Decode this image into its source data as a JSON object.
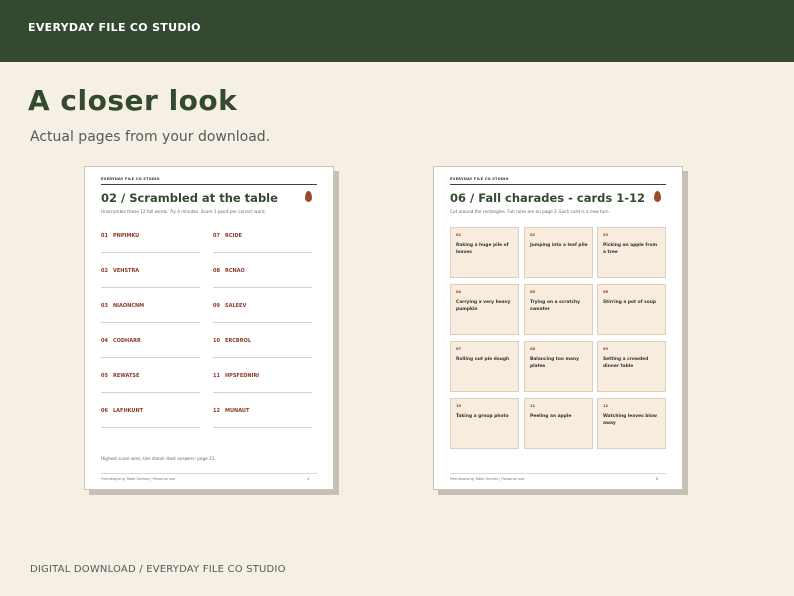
{
  "header": {
    "brand": "EVERYDAY FILE CO STUDIO"
  },
  "main": {
    "headline": "A closer look",
    "subline": "Actual pages from your download."
  },
  "footer": {
    "text": "DIGITAL DOWNLOAD / EVERYDAY FILE CO STUDIO"
  },
  "colors": {
    "green": "#334a31",
    "rust": "#8a3a22",
    "cream": "#f5f0e3",
    "card": "#f7ecdd"
  },
  "page_left": {
    "brand": "EVERYDAY FILE CO STUDIO",
    "title": "02 / Scrambled at the table",
    "subtitle": "Unscramble these 12 fall words. Try 4 minutes. Score 1 point per correct word.",
    "words": [
      {
        "num": "01",
        "word": "PNPIMKU"
      },
      {
        "num": "07",
        "word": "RCIDE"
      },
      {
        "num": "02",
        "word": "VEHSTRA"
      },
      {
        "num": "08",
        "word": "RCNAO"
      },
      {
        "num": "03",
        "word": "NIAONCNM"
      },
      {
        "num": "09",
        "word": "SALEEV"
      },
      {
        "num": "04",
        "word": "CODHARR"
      },
      {
        "num": "10",
        "word": "ERCBROL"
      },
      {
        "num": "05",
        "word": "REWATSE"
      },
      {
        "num": "11",
        "word": "HPSFEDNIRI"
      },
      {
        "num": "06",
        "word": "LAFHKUNT"
      },
      {
        "num": "12",
        "word": "MUNAUT"
      }
    ],
    "note": "Highest score wins; ties stand. Host answers: page 11.",
    "foot": "Friendsgiving Table Games | Personal use",
    "page_num": "4"
  },
  "page_right": {
    "brand": "EVERYDAY FILE CO STUDIO",
    "title": "06 / Fall charades - cards 1-12",
    "subtitle": "Cut around the rectangles. Full rules are on page 2. Each card is a new turn.",
    "cards": [
      {
        "num": "01",
        "text": "Raking a huge pile of leaves"
      },
      {
        "num": "02",
        "text": "Jumping into a leaf pile"
      },
      {
        "num": "03",
        "text": "Picking an apple from a tree"
      },
      {
        "num": "04",
        "text": "Carrying a very heavy pumpkin"
      },
      {
        "num": "05",
        "text": "Trying on a scratchy sweater"
      },
      {
        "num": "06",
        "text": "Stirring a pot of soup"
      },
      {
        "num": "07",
        "text": "Rolling out pie dough"
      },
      {
        "num": "08",
        "text": "Balancing too many plates"
      },
      {
        "num": "09",
        "text": "Setting a crowded dinner table"
      },
      {
        "num": "10",
        "text": "Taking a group photo"
      },
      {
        "num": "11",
        "text": "Peeling an apple"
      },
      {
        "num": "12",
        "text": "Watching leaves blow away"
      }
    ],
    "foot": "Friendsgiving Table Games | Personal use",
    "page_num": "8"
  }
}
